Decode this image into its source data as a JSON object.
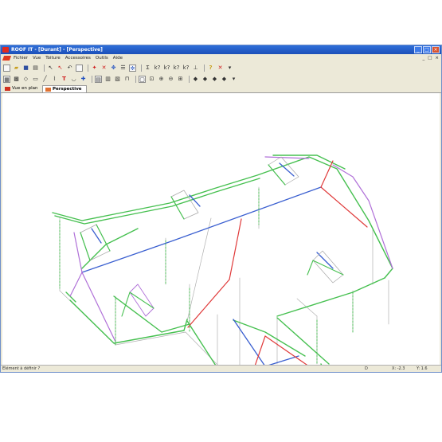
{
  "window": {
    "title": "ROOF IT - [Durant] - [Perspective]",
    "controls": [
      "_",
      "□",
      "×"
    ]
  },
  "menu": {
    "items": [
      "Fichier",
      "Vue",
      "Toiture",
      "Accessoires",
      "Outils",
      "Aide"
    ],
    "child_controls": [
      "_",
      "□",
      "×"
    ]
  },
  "toolbar": {
    "sigma_label": "Σ",
    "query_label": "k?",
    "help_label": "?",
    "delete_label": "✕",
    "text_tool_label": "T"
  },
  "tabs": [
    {
      "label": "Vue en plan",
      "active": false
    },
    {
      "label": "Perspective",
      "active": true
    }
  ],
  "status": {
    "message": "Elément à définir ?",
    "mode": "D",
    "x": "X: -2.3",
    "y": "Y: 1.6"
  },
  "colors": {
    "titlebar": "#1b4fb8",
    "window_frame": "#ece9d8",
    "roof_edge_green": "#46c050",
    "ridge_blue": "#3a5fd0",
    "hip_red": "#e03a3a",
    "valley_purple": "#b070d8",
    "wall_gray": "#a8a8a8"
  }
}
